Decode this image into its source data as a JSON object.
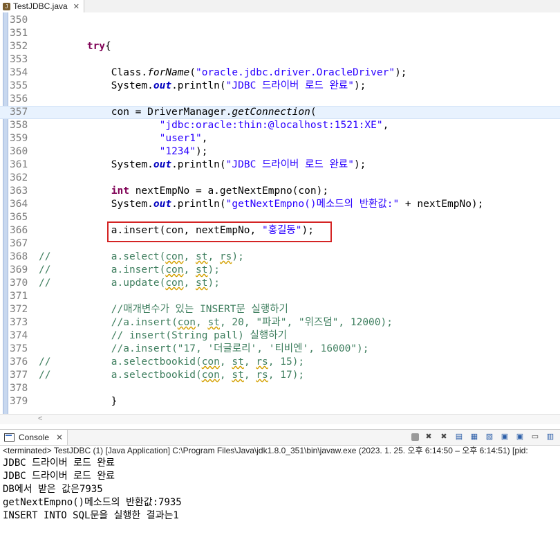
{
  "editor_tab": {
    "title": "TestJDBC.java",
    "close": "✕"
  },
  "code_lines": [
    {
      "n": "350",
      "html": ""
    },
    {
      "n": "351",
      "html": ""
    },
    {
      "n": "352",
      "html": "        <span class=\"kw\">try</span>{"
    },
    {
      "n": "353",
      "html": ""
    },
    {
      "n": "354",
      "html": "            Class.<span class=\"it\">forName</span>(<span class=\"str\">\"oracle.jdbc.driver.OracleDriver\"</span>);"
    },
    {
      "n": "355",
      "html": "            System.<span class=\"fld\">out</span>.println(<span class=\"str\">\"JDBC 드라이버 로드 완료\"</span>);"
    },
    {
      "n": "356",
      "html": ""
    },
    {
      "n": "357",
      "html": "            con = DriverManager.<span class=\"it\">getConnection</span>(",
      "current": true
    },
    {
      "n": "358",
      "html": "                    <span class=\"str\">\"jdbc:oracle:thin:@localhost:1521:XE\"</span>,"
    },
    {
      "n": "359",
      "html": "                    <span class=\"str\">\"user1\"</span>,"
    },
    {
      "n": "360",
      "html": "                    <span class=\"str\">\"1234\"</span>);"
    },
    {
      "n": "361",
      "html": "            System.<span class=\"fld\">out</span>.println(<span class=\"str\">\"JDBC 드라이버 로드 완료\"</span>);"
    },
    {
      "n": "362",
      "html": ""
    },
    {
      "n": "363",
      "html": "            <span class=\"kw\">int</span> nextEmpNo = a.getNextEmpno(con);"
    },
    {
      "n": "364",
      "html": "            System.<span class=\"fld\">out</span>.println(<span class=\"str\">\"getNextEmpno()메소드의 반환값:\"</span> + nextEmpNo);"
    },
    {
      "n": "365",
      "html": ""
    },
    {
      "n": "366",
      "html": "            a.insert(con, nextEmpNo, <span class=\"str\">\"홍길동\"</span>);"
    },
    {
      "n": "367",
      "html": ""
    },
    {
      "n": "368",
      "html": "<span class=\"cm\">//          a.select(<span class=\"warn\">con</span>, <span class=\"warn\">st</span>, <span class=\"warn\">rs</span>);</span>"
    },
    {
      "n": "369",
      "html": "<span class=\"cm\">//          a.insert(<span class=\"warn\">con</span>, <span class=\"warn\">st</span>);</span>"
    },
    {
      "n": "370",
      "html": "<span class=\"cm\">//          a.update(<span class=\"warn\">con</span>, <span class=\"warn\">st</span>);</span>"
    },
    {
      "n": "371",
      "html": ""
    },
    {
      "n": "372",
      "html": "            <span class=\"cm\">//매개변수가 있는 INSERT문 실행하기</span>"
    },
    {
      "n": "373",
      "html": "            <span class=\"cm\">//a.insert(<span class=\"warn\">con</span>, <span class=\"warn\">st</span>, 20, \"파과\", \"위즈덤\", 12000);</span>"
    },
    {
      "n": "374",
      "html": "            <span class=\"cm\">// insert(String pall) 실행하기</span>"
    },
    {
      "n": "375",
      "html": "            <span class=\"cm\">//a.insert(\"17, '더글로리', '티비엔', 16000\");</span>"
    },
    {
      "n": "376",
      "html": "<span class=\"cm\">//          a.selectbookid(<span class=\"warn\">con</span>, <span class=\"warn\">st</span>, <span class=\"warn\">rs</span>, 15);</span>"
    },
    {
      "n": "377",
      "html": "<span class=\"cm\">//          a.selectbookid(<span class=\"warn\">con</span>, <span class=\"warn\">st</span>, <span class=\"warn\">rs</span>, 17);</span>"
    },
    {
      "n": "378",
      "html": ""
    },
    {
      "n": "379",
      "html": "            }"
    }
  ],
  "console": {
    "tab_label": "Console",
    "close": "✕",
    "terminated": "<terminated> TestJDBC (1) [Java Application] C:\\Program Files\\Java\\jdk1.8.0_351\\bin\\javaw.exe  (2023. 1. 25. 오후 6:14:50 – 오후 6:14:51) [pid:",
    "output": [
      "JDBC 드라이버 로드 완료",
      "JDBC 드라이버 로드 완료",
      "DB에서 받은 값은7935",
      "getNextEmpno()메소드의 반환값:7935",
      "INSERT INTO SQL문을 실행한 결과는1"
    ]
  },
  "colors": {
    "keyword": "#7f0055",
    "string": "#2a00ff",
    "comment": "#3f7f5f",
    "highlight_box": "#d42424"
  }
}
